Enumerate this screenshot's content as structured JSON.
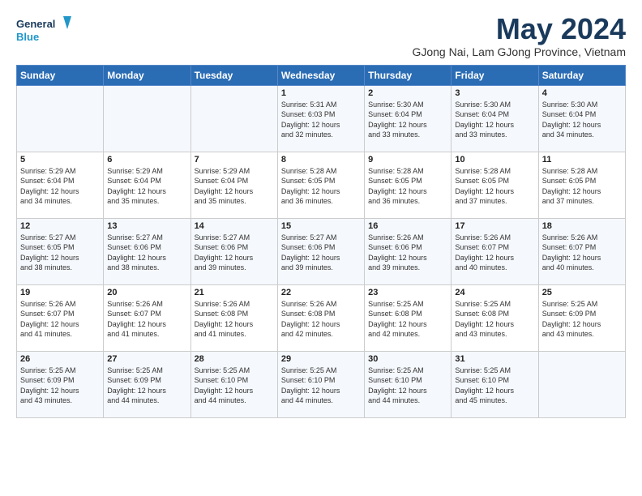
{
  "header": {
    "logo_line1": "General",
    "logo_line2": "Blue",
    "month": "May 2024",
    "location": "GJong Nai, Lam GJong Province, Vietnam"
  },
  "days_of_week": [
    "Sunday",
    "Monday",
    "Tuesday",
    "Wednesday",
    "Thursday",
    "Friday",
    "Saturday"
  ],
  "weeks": [
    [
      {
        "day": "",
        "info": ""
      },
      {
        "day": "",
        "info": ""
      },
      {
        "day": "",
        "info": ""
      },
      {
        "day": "1",
        "info": "Sunrise: 5:31 AM\nSunset: 6:03 PM\nDaylight: 12 hours\nand 32 minutes."
      },
      {
        "day": "2",
        "info": "Sunrise: 5:30 AM\nSunset: 6:04 PM\nDaylight: 12 hours\nand 33 minutes."
      },
      {
        "day": "3",
        "info": "Sunrise: 5:30 AM\nSunset: 6:04 PM\nDaylight: 12 hours\nand 33 minutes."
      },
      {
        "day": "4",
        "info": "Sunrise: 5:30 AM\nSunset: 6:04 PM\nDaylight: 12 hours\nand 34 minutes."
      }
    ],
    [
      {
        "day": "5",
        "info": "Sunrise: 5:29 AM\nSunset: 6:04 PM\nDaylight: 12 hours\nand 34 minutes."
      },
      {
        "day": "6",
        "info": "Sunrise: 5:29 AM\nSunset: 6:04 PM\nDaylight: 12 hours\nand 35 minutes."
      },
      {
        "day": "7",
        "info": "Sunrise: 5:29 AM\nSunset: 6:04 PM\nDaylight: 12 hours\nand 35 minutes."
      },
      {
        "day": "8",
        "info": "Sunrise: 5:28 AM\nSunset: 6:05 PM\nDaylight: 12 hours\nand 36 minutes."
      },
      {
        "day": "9",
        "info": "Sunrise: 5:28 AM\nSunset: 6:05 PM\nDaylight: 12 hours\nand 36 minutes."
      },
      {
        "day": "10",
        "info": "Sunrise: 5:28 AM\nSunset: 6:05 PM\nDaylight: 12 hours\nand 37 minutes."
      },
      {
        "day": "11",
        "info": "Sunrise: 5:28 AM\nSunset: 6:05 PM\nDaylight: 12 hours\nand 37 minutes."
      }
    ],
    [
      {
        "day": "12",
        "info": "Sunrise: 5:27 AM\nSunset: 6:05 PM\nDaylight: 12 hours\nand 38 minutes."
      },
      {
        "day": "13",
        "info": "Sunrise: 5:27 AM\nSunset: 6:06 PM\nDaylight: 12 hours\nand 38 minutes."
      },
      {
        "day": "14",
        "info": "Sunrise: 5:27 AM\nSunset: 6:06 PM\nDaylight: 12 hours\nand 39 minutes."
      },
      {
        "day": "15",
        "info": "Sunrise: 5:27 AM\nSunset: 6:06 PM\nDaylight: 12 hours\nand 39 minutes."
      },
      {
        "day": "16",
        "info": "Sunrise: 5:26 AM\nSunset: 6:06 PM\nDaylight: 12 hours\nand 39 minutes."
      },
      {
        "day": "17",
        "info": "Sunrise: 5:26 AM\nSunset: 6:07 PM\nDaylight: 12 hours\nand 40 minutes."
      },
      {
        "day": "18",
        "info": "Sunrise: 5:26 AM\nSunset: 6:07 PM\nDaylight: 12 hours\nand 40 minutes."
      }
    ],
    [
      {
        "day": "19",
        "info": "Sunrise: 5:26 AM\nSunset: 6:07 PM\nDaylight: 12 hours\nand 41 minutes."
      },
      {
        "day": "20",
        "info": "Sunrise: 5:26 AM\nSunset: 6:07 PM\nDaylight: 12 hours\nand 41 minutes."
      },
      {
        "day": "21",
        "info": "Sunrise: 5:26 AM\nSunset: 6:08 PM\nDaylight: 12 hours\nand 41 minutes."
      },
      {
        "day": "22",
        "info": "Sunrise: 5:26 AM\nSunset: 6:08 PM\nDaylight: 12 hours\nand 42 minutes."
      },
      {
        "day": "23",
        "info": "Sunrise: 5:25 AM\nSunset: 6:08 PM\nDaylight: 12 hours\nand 42 minutes."
      },
      {
        "day": "24",
        "info": "Sunrise: 5:25 AM\nSunset: 6:08 PM\nDaylight: 12 hours\nand 43 minutes."
      },
      {
        "day": "25",
        "info": "Sunrise: 5:25 AM\nSunset: 6:09 PM\nDaylight: 12 hours\nand 43 minutes."
      }
    ],
    [
      {
        "day": "26",
        "info": "Sunrise: 5:25 AM\nSunset: 6:09 PM\nDaylight: 12 hours\nand 43 minutes."
      },
      {
        "day": "27",
        "info": "Sunrise: 5:25 AM\nSunset: 6:09 PM\nDaylight: 12 hours\nand 44 minutes."
      },
      {
        "day": "28",
        "info": "Sunrise: 5:25 AM\nSunset: 6:10 PM\nDaylight: 12 hours\nand 44 minutes."
      },
      {
        "day": "29",
        "info": "Sunrise: 5:25 AM\nSunset: 6:10 PM\nDaylight: 12 hours\nand 44 minutes."
      },
      {
        "day": "30",
        "info": "Sunrise: 5:25 AM\nSunset: 6:10 PM\nDaylight: 12 hours\nand 44 minutes."
      },
      {
        "day": "31",
        "info": "Sunrise: 5:25 AM\nSunset: 6:10 PM\nDaylight: 12 hours\nand 45 minutes."
      },
      {
        "day": "",
        "info": ""
      }
    ]
  ]
}
